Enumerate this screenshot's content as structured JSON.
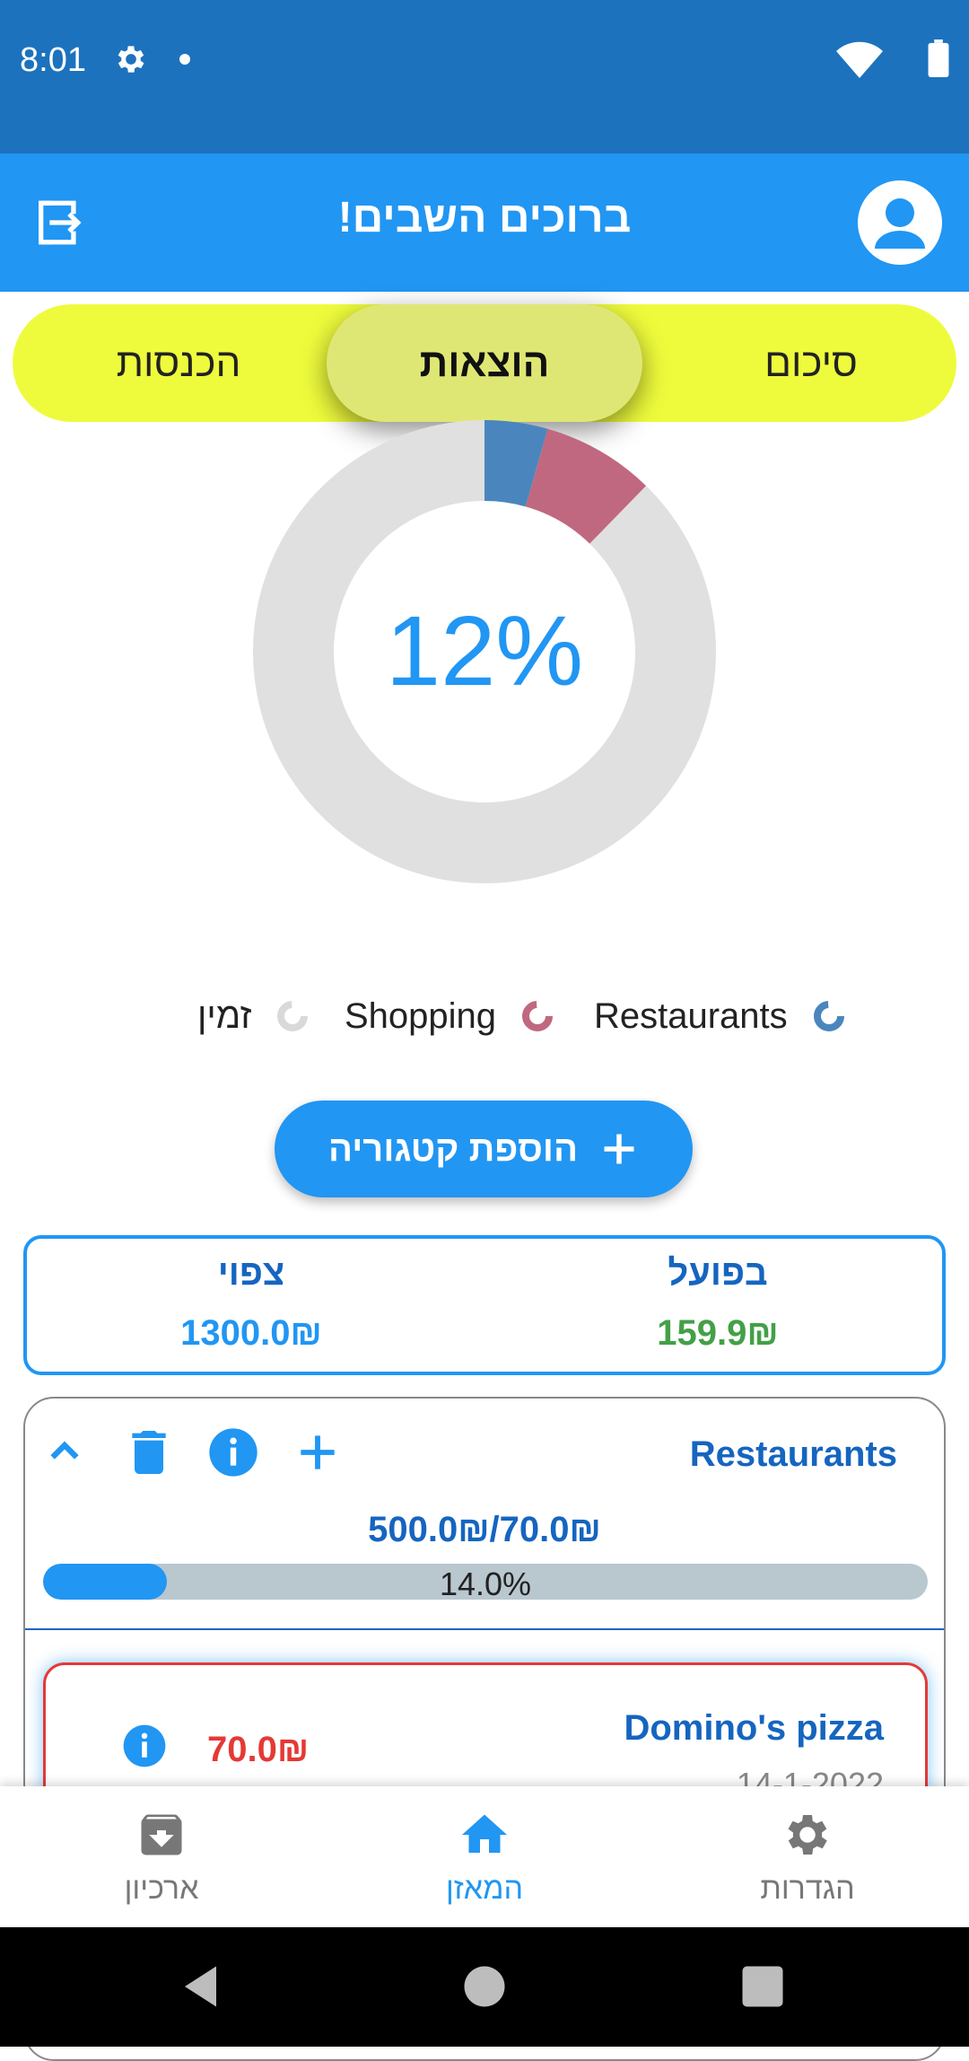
{
  "status_bar": {
    "time": "8:01"
  },
  "app_bar": {
    "title": "ברוכים השבים!"
  },
  "tabs": [
    {
      "label": "הכנסות",
      "active": false
    },
    {
      "label": "הוצאות",
      "active": true
    },
    {
      "label": "סיכום",
      "active": false
    }
  ],
  "donut": {
    "center_label": "12%",
    "segments": [
      {
        "name": "Restaurants",
        "percent": 4.4,
        "color": "#4a86bd"
      },
      {
        "name": "Shopping",
        "percent": 7.9,
        "color": "#c0687f"
      },
      {
        "name": "זמין",
        "percent": 87.7,
        "color": "#e0e0e0"
      }
    ]
  },
  "legend": [
    {
      "label": "Restaurants",
      "color": "#4a86bd"
    },
    {
      "label": "Shopping",
      "color": "#c0687f"
    },
    {
      "label": "זמין",
      "color": "#e0e0e0"
    }
  ],
  "add_category_button": {
    "label": "הוספת קטגוריה"
  },
  "summary": {
    "actual_label": "בפועל",
    "actual_value": "159.9₪",
    "expected_label": "צפוי",
    "expected_value": "1300.0₪"
  },
  "category_card": {
    "name": "Restaurants",
    "amount": "500.0₪/70.0₪",
    "progress_percent": 14.0,
    "progress_label": "14.0%",
    "entries": [
      {
        "name": "Domino's pizza",
        "date": "14-1-2022",
        "amount": "70.0₪"
      }
    ]
  },
  "bottom_nav": [
    {
      "label": "ארכיון",
      "icon": "archive-icon",
      "active": false
    },
    {
      "label": "המאזן",
      "icon": "home-icon",
      "active": true
    },
    {
      "label": "הגדרות",
      "icon": "settings-icon",
      "active": false
    }
  ],
  "colors": {
    "primary": "#2196f3",
    "status_bar": "#1c72bd",
    "tab_bar": "#eefb3c",
    "positive": "#43a047",
    "negative": "#e53935"
  }
}
